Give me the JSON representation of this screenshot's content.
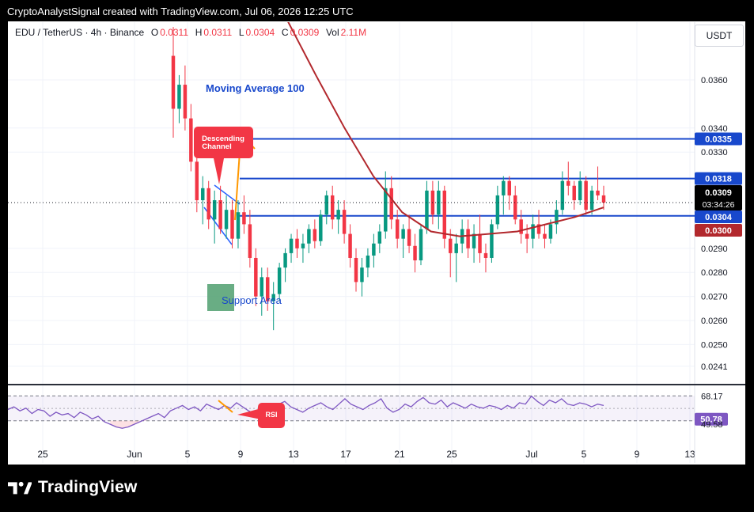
{
  "credit": "CryptoAnalystSignal created with TradingView.com, Jul 06, 2026 12:25 UTC",
  "legend": {
    "symbol": "EDU / TetherUS · 4h · Binance",
    "o_label": "O",
    "o_value": "0.0311",
    "h_label": "H",
    "h_value": "0.0311",
    "l_label": "L",
    "l_value": "0.0304",
    "c_label": "C",
    "c_value": "0.0309",
    "vol_label": "Vol",
    "vol_value": "2.11M"
  },
  "currency_button": "USDT",
  "footer_brand": "TradingView",
  "colors": {
    "up": "#089981",
    "down": "#f23645",
    "ma": "#b2282d",
    "level": "#1848cc",
    "rsi": "#7e57c2"
  },
  "chart_data": [
    {
      "type": "candlestick",
      "title": "EDU / TetherUS · 4h · Binance",
      "ylim": [
        0.0236,
        0.0384
      ],
      "y_ticks": [
        "0.0360",
        "0.0340",
        "0.0330",
        "0.0290",
        "0.0280",
        "0.0270",
        "0.0260",
        "0.0250",
        "0.0241"
      ],
      "x_ticks": [
        "25",
        "Jun",
        "5",
        "9",
        "13",
        "17",
        "21",
        "25",
        "Jul",
        "5",
        "9",
        "13"
      ],
      "horizontal_levels": [
        {
          "label": "0.0335",
          "value": 0.03355
        },
        {
          "label": "0.0318",
          "value": 0.0319
        },
        {
          "label": "0.0304",
          "value": 0.03035
        }
      ],
      "price_tags": [
        {
          "value": "0.0309",
          "sub": "03:34:26",
          "kind": "current"
        },
        {
          "value": "0.0300",
          "kind": "ma"
        }
      ],
      "annotations": [
        {
          "text": "Moving Average 100"
        },
        {
          "text": "Descending Channel"
        },
        {
          "text": "Support Area"
        }
      ],
      "ma100": [
        0.0435,
        0.041,
        0.0385,
        0.0362,
        0.034,
        0.032,
        0.0305,
        0.0297,
        0.0295,
        0.0296,
        0.0297,
        0.03,
        0.0303,
        0.0307
      ],
      "candles": [
        [
          0.037,
          0.0382,
          0.0336,
          0.0348
        ],
        [
          0.0348,
          0.0362,
          0.0342,
          0.0358
        ],
        [
          0.0358,
          0.0366,
          0.0339,
          0.0344
        ],
        [
          0.0344,
          0.035,
          0.0322,
          0.0326
        ],
        [
          0.0326,
          0.0332,
          0.0305,
          0.031
        ],
        [
          0.031,
          0.032,
          0.03,
          0.0315
        ],
        [
          0.0315,
          0.0318,
          0.0298,
          0.0302
        ],
        [
          0.0302,
          0.0314,
          0.0292,
          0.031
        ],
        [
          0.031,
          0.0316,
          0.0296,
          0.0298
        ],
        [
          0.0298,
          0.0312,
          0.0294,
          0.0306
        ],
        [
          0.0306,
          0.031,
          0.029,
          0.0294
        ],
        [
          0.0294,
          0.031,
          0.029,
          0.0305
        ],
        [
          0.0305,
          0.0312,
          0.0296,
          0.03
        ],
        [
          0.03,
          0.0306,
          0.0282,
          0.0286
        ],
        [
          0.0286,
          0.029,
          0.0266,
          0.027
        ],
        [
          0.027,
          0.0282,
          0.0262,
          0.0278
        ],
        [
          0.0278,
          0.0282,
          0.0264,
          0.0268
        ],
        [
          0.0268,
          0.0276,
          0.0256,
          0.0271
        ],
        [
          0.0271,
          0.0284,
          0.0268,
          0.0282
        ],
        [
          0.0282,
          0.029,
          0.0276,
          0.0288
        ],
        [
          0.0288,
          0.0296,
          0.0284,
          0.0294
        ],
        [
          0.0294,
          0.0298,
          0.0286,
          0.029
        ],
        [
          0.029,
          0.0296,
          0.0284,
          0.0292
        ],
        [
          0.0292,
          0.03,
          0.0288,
          0.0298
        ],
        [
          0.0298,
          0.0302,
          0.029,
          0.0293
        ],
        [
          0.0293,
          0.0306,
          0.0291,
          0.0304
        ],
        [
          0.0304,
          0.0314,
          0.03,
          0.0312
        ],
        [
          0.0312,
          0.0316,
          0.0298,
          0.0302
        ],
        [
          0.0302,
          0.031,
          0.0296,
          0.0306
        ],
        [
          0.0306,
          0.031,
          0.0292,
          0.0296
        ],
        [
          0.0296,
          0.03,
          0.0282,
          0.0286
        ],
        [
          0.0286,
          0.029,
          0.0272,
          0.0276
        ],
        [
          0.0276,
          0.0286,
          0.027,
          0.0282
        ],
        [
          0.0282,
          0.029,
          0.0278,
          0.0287
        ],
        [
          0.0287,
          0.0296,
          0.0282,
          0.0292
        ],
        [
          0.0292,
          0.03,
          0.0288,
          0.0297
        ],
        [
          0.0297,
          0.0322,
          0.0294,
          0.0315
        ],
        [
          0.0315,
          0.032,
          0.0298,
          0.0302
        ],
        [
          0.0302,
          0.0306,
          0.029,
          0.0294
        ],
        [
          0.0294,
          0.03,
          0.0286,
          0.0298
        ],
        [
          0.0298,
          0.0304,
          0.0288,
          0.0291
        ],
        [
          0.0291,
          0.0296,
          0.028,
          0.0285
        ],
        [
          0.0285,
          0.03,
          0.0283,
          0.0298
        ],
        [
          0.0298,
          0.0318,
          0.0296,
          0.0314
        ],
        [
          0.0314,
          0.0318,
          0.03,
          0.0304
        ],
        [
          0.0304,
          0.0318,
          0.0298,
          0.0314
        ],
        [
          0.0314,
          0.0316,
          0.029,
          0.0294
        ],
        [
          0.0294,
          0.0298,
          0.0278,
          0.0288
        ],
        [
          0.0288,
          0.0296,
          0.0276,
          0.0292
        ],
        [
          0.0292,
          0.0302,
          0.0288,
          0.0298
        ],
        [
          0.0298,
          0.0302,
          0.0286,
          0.029
        ],
        [
          0.029,
          0.03,
          0.0284,
          0.0296
        ],
        [
          0.0296,
          0.0304,
          0.0284,
          0.0288
        ],
        [
          0.0288,
          0.0292,
          0.028,
          0.0286
        ],
        [
          0.0286,
          0.0302,
          0.0284,
          0.03
        ],
        [
          0.03,
          0.0316,
          0.0298,
          0.0312
        ],
        [
          0.0312,
          0.032,
          0.0304,
          0.0318
        ],
        [
          0.0318,
          0.032,
          0.0306,
          0.0312
        ],
        [
          0.0312,
          0.0316,
          0.03,
          0.0302
        ],
        [
          0.0302,
          0.0306,
          0.0292,
          0.0296
        ],
        [
          0.0296,
          0.03,
          0.0288,
          0.0294
        ],
        [
          0.0294,
          0.0304,
          0.029,
          0.03
        ],
        [
          0.03,
          0.0306,
          0.0294,
          0.0296
        ],
        [
          0.0296,
          0.03,
          0.029,
          0.0294
        ],
        [
          0.0294,
          0.0302,
          0.0292,
          0.03
        ],
        [
          0.03,
          0.031,
          0.0296,
          0.0306
        ],
        [
          0.0306,
          0.0322,
          0.0304,
          0.0318
        ],
        [
          0.0318,
          0.0326,
          0.0312,
          0.0316
        ],
        [
          0.0316,
          0.0318,
          0.0306,
          0.031
        ],
        [
          0.031,
          0.0322,
          0.0308,
          0.0318
        ],
        [
          0.0318,
          0.032,
          0.0304,
          0.0306
        ],
        [
          0.0306,
          0.0316,
          0.0304,
          0.0314
        ],
        [
          0.0314,
          0.0324,
          0.031,
          0.0312
        ],
        [
          0.0312,
          0.0316,
          0.0306,
          0.0309
        ]
      ]
    },
    {
      "type": "line",
      "title": "RSI",
      "ylim": [
        40,
        76
      ],
      "levels": [
        {
          "label": "68.17",
          "value": 68.17
        },
        {
          "label": "49.58",
          "value": 49.58
        }
      ],
      "current": {
        "label": "50.78",
        "value": 50.78
      },
      "annotations": [
        {
          "text": "RSI"
        }
      ],
      "values": [
        58,
        60,
        57,
        59,
        55,
        58,
        57,
        53,
        56,
        54,
        55,
        52,
        56,
        54,
        51,
        53,
        49,
        47,
        45,
        44,
        45,
        47,
        49,
        51,
        53,
        55,
        52,
        57,
        59,
        61,
        58,
        60,
        57,
        62,
        60,
        58,
        61,
        59,
        63,
        60,
        57,
        55,
        58,
        61,
        59,
        62,
        64,
        60,
        58,
        56,
        59,
        61,
        63,
        60,
        58,
        62,
        66,
        62,
        60,
        58,
        61,
        63,
        66,
        59,
        56,
        58,
        62,
        60,
        64,
        67,
        63,
        62,
        65,
        60,
        63,
        61,
        59,
        62,
        60,
        59,
        61,
        60,
        58,
        61,
        59,
        63,
        62,
        68,
        64,
        61,
        65,
        63,
        66,
        62,
        61,
        63,
        62,
        60,
        62,
        61
      ]
    }
  ]
}
